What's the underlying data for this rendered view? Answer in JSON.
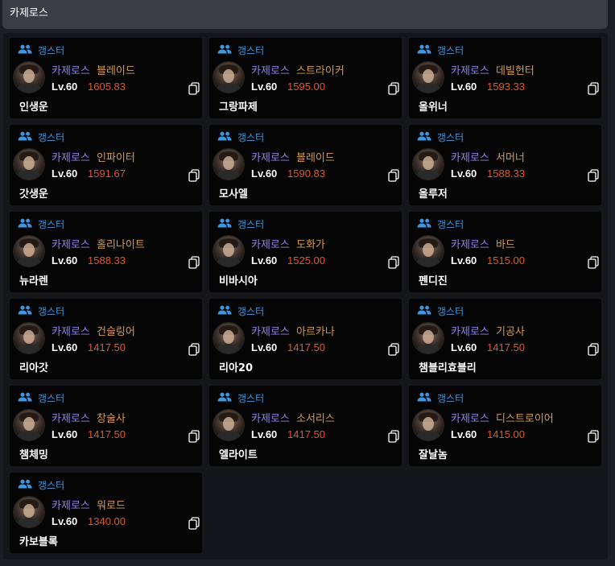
{
  "header": {
    "title": "카제로스"
  },
  "guild_icon": "group-icon",
  "copy_icon": "copy-icon",
  "colors": {
    "guild": "#3e97e0",
    "server": "#8f83f1",
    "class": "#d89a4d",
    "item_level": "#e0582b"
  },
  "characters": [
    {
      "guild": "갱스터",
      "server": "카제로스",
      "class": "블레이드",
      "level": "Lv.60",
      "item_level": "1605.83",
      "name": "인생운"
    },
    {
      "guild": "갱스터",
      "server": "카제로스",
      "class": "스트라이커",
      "level": "Lv.60",
      "item_level": "1595.00",
      "name": "그랑파제"
    },
    {
      "guild": "갱스터",
      "server": "카제로스",
      "class": "데빌헌터",
      "level": "Lv.60",
      "item_level": "1593.33",
      "name": "올위너"
    },
    {
      "guild": "갱스터",
      "server": "카제로스",
      "class": "인파이터",
      "level": "Lv.60",
      "item_level": "1591.67",
      "name": "갓생운"
    },
    {
      "guild": "갱스터",
      "server": "카제로스",
      "class": "블레이드",
      "level": "Lv.60",
      "item_level": "1590.83",
      "name": "모사엘"
    },
    {
      "guild": "갱스터",
      "server": "카제로스",
      "class": "서머너",
      "level": "Lv.60",
      "item_level": "1588.33",
      "name": "올루저"
    },
    {
      "guild": "갱스터",
      "server": "카제로스",
      "class": "홀리나이트",
      "level": "Lv.60",
      "item_level": "1588.33",
      "name": "뉴라렌"
    },
    {
      "guild": "갱스터",
      "server": "카제로스",
      "class": "도화가",
      "level": "Lv.60",
      "item_level": "1525.00",
      "name": "비바시아"
    },
    {
      "guild": "갱스터",
      "server": "카제로스",
      "class": "바드",
      "level": "Lv.60",
      "item_level": "1515.00",
      "name": "펜디진"
    },
    {
      "guild": "갱스터",
      "server": "카제로스",
      "class": "건슬링어",
      "level": "Lv.60",
      "item_level": "1417.50",
      "name": "리아갓"
    },
    {
      "guild": "갱스터",
      "server": "카제로스",
      "class": "아르카나",
      "level": "Lv.60",
      "item_level": "1417.50",
      "name": "리아20"
    },
    {
      "guild": "갱스터",
      "server": "카제로스",
      "class": "기공사",
      "level": "Lv.60",
      "item_level": "1417.50",
      "name": "챔블리효블리"
    },
    {
      "guild": "갱스터",
      "server": "카제로스",
      "class": "창술사",
      "level": "Lv.60",
      "item_level": "1417.50",
      "name": "챔체밍"
    },
    {
      "guild": "갱스터",
      "server": "카제로스",
      "class": "소서리스",
      "level": "Lv.60",
      "item_level": "1417.50",
      "name": "엘라이트"
    },
    {
      "guild": "갱스터",
      "server": "카제로스",
      "class": "디스트로이어",
      "level": "Lv.60",
      "item_level": "1415.00",
      "name": "잘날놈"
    },
    {
      "guild": "갱스터",
      "server": "카제로스",
      "class": "워로드",
      "level": "Lv.60",
      "item_level": "1340.00",
      "name": "카보블록"
    }
  ]
}
